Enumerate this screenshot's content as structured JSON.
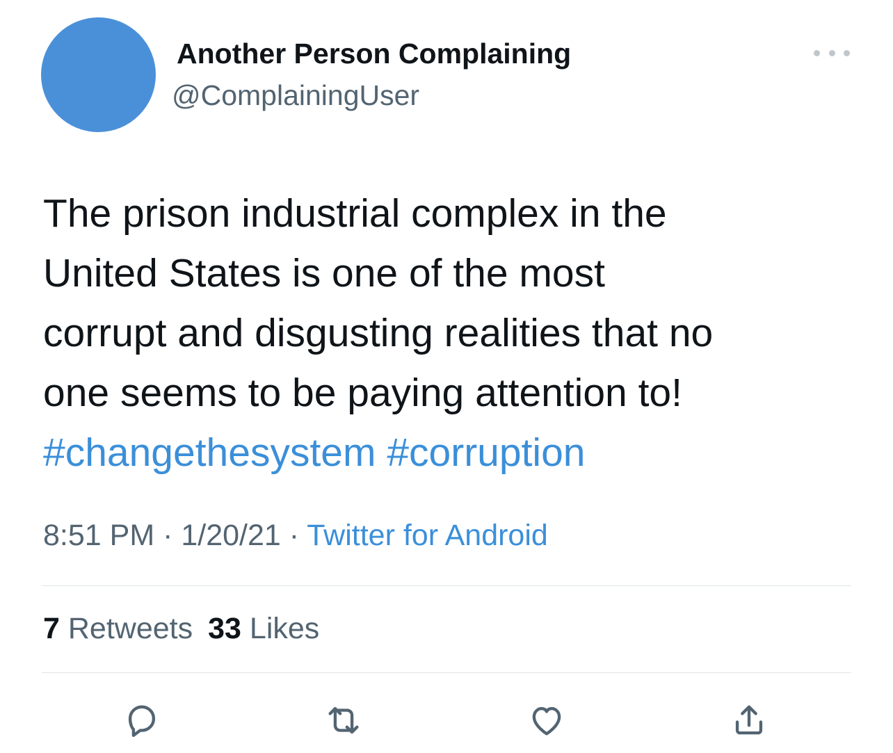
{
  "author": {
    "display_name": "Another Person Complaining",
    "handle": "@ComplainingUser",
    "avatar_color": "#4a90d9"
  },
  "tweet": {
    "lines": [
      "The prison industrial complex in the",
      "United States is one of the most",
      "corrupt and disgusting realities that no",
      "one seems to be paying attention to!"
    ],
    "hashtags": [
      "#changethesystem",
      "#corruption"
    ]
  },
  "meta": {
    "time": "8:51 PM",
    "separator": " · ",
    "date": "1/20/21",
    "source": "Twitter for Android"
  },
  "stats": {
    "retweets_count": "7",
    "retweets_label": "Retweets",
    "likes_count": "33",
    "likes_label": "Likes"
  },
  "actions": [
    "reply-icon",
    "retweet-icon",
    "like-icon",
    "share-icon"
  ],
  "colors": {
    "link": "#3b8fd9",
    "text": "#0f1419",
    "secondary": "#536471"
  }
}
